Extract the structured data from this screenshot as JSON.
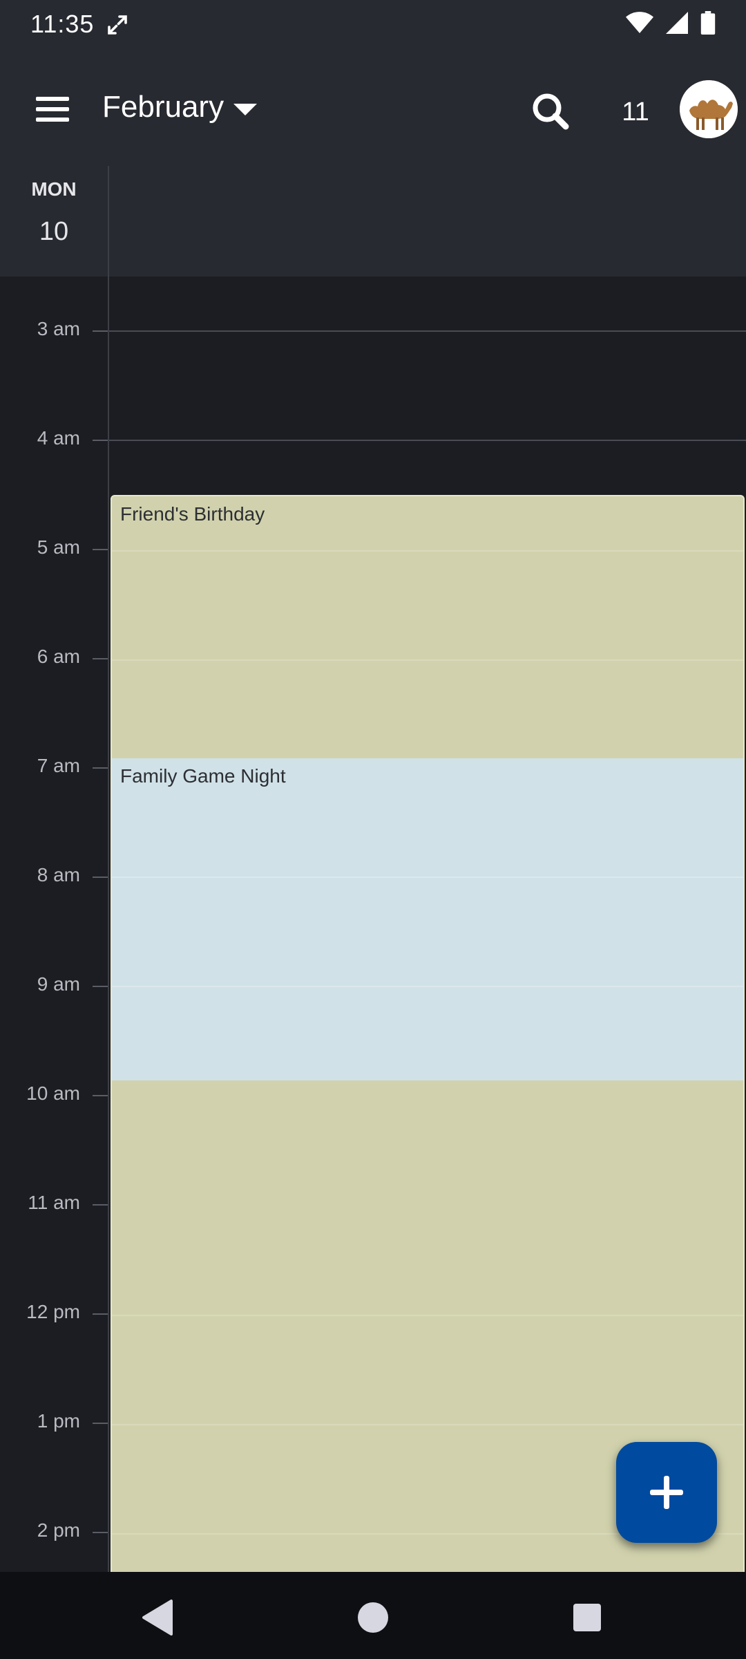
{
  "status_bar": {
    "time": "11:35",
    "icons": [
      "expand-icon",
      "wifi-icon",
      "cellular-icon",
      "battery-icon"
    ]
  },
  "app_bar": {
    "menu_icon": "hamburger-menu-icon",
    "month": "February",
    "caret_icon": "caret-down-icon",
    "search_icon": "search-icon",
    "today_date": "11",
    "avatar_icon": "camel-avatar-icon"
  },
  "day_header": {
    "day_name": "MON",
    "day_number": "10"
  },
  "timeline": {
    "hours": [
      "3 am",
      "4 am",
      "5 am",
      "6 am",
      "7 am",
      "8 am",
      "9 am",
      "10 am",
      "11 am",
      "12 pm",
      "1 pm",
      "2 pm"
    ]
  },
  "events": [
    {
      "title": "Friend's Birthday",
      "color": "#d1d2ad"
    },
    {
      "title": "Family Game Night",
      "color": "#d0e1e7"
    }
  ],
  "fab": {
    "icon": "plus-icon"
  },
  "nav_bar": {
    "icons": [
      "back-icon",
      "home-icon",
      "recents-icon"
    ]
  },
  "colors": {
    "background": "#1c1d22",
    "app_bar": "#282a31",
    "accent": "#004a9f",
    "birthday_event": "#d1d2ad",
    "game_night_event": "#d0e1e7"
  }
}
